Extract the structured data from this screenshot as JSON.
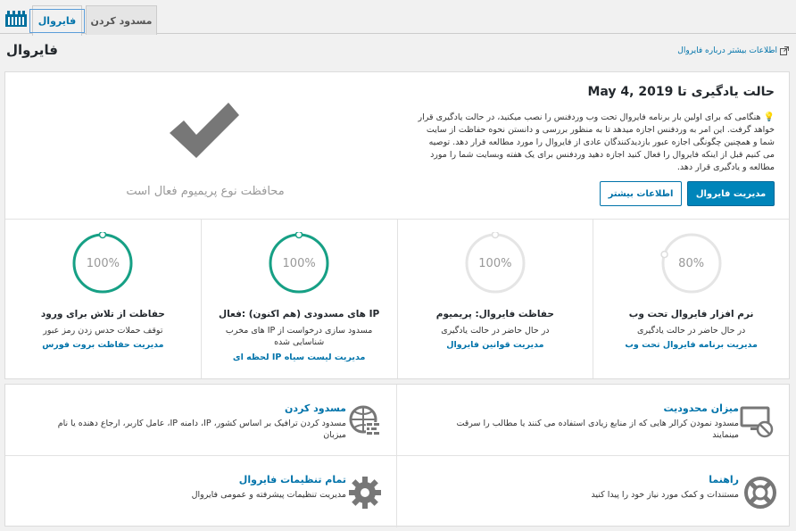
{
  "tabs": [
    {
      "label": "فایروال",
      "active": true
    },
    {
      "label": "مسدود کردن",
      "active": false
    }
  ],
  "learn_more_link": "اطلاعات بیشتر درباره فایروال",
  "page_title": "فایروال",
  "status": {
    "title": "حالت یادگیری تا May 4, 2019",
    "description": "هنگامی که برای اولین بار برنامه فایروال تحت وب وردفنس را نصب میکنید، در حالت یادگیری قرار خواهد گرفت. این امر به وردفنس اجازه میدهد تا به منظور بررسی و دانستن نحوه حفاظت از سایت شما و همچنین چگونگی اجازه عبور بازدیدکنندگان عادی از فایروال را مورد مطالعه قرار دهد. توصیه می کنیم قبل از اینکه فایروال را فعال کنید اجازه دهید وردفنس برای یک هفته وبسایت شما را مورد مطالعه و یادگیری قرار دهد.",
    "primary_button": "مدیریت فایروال",
    "secondary_button": "اطلاعات بیشتر",
    "premium_text": "محافظت نوع پریمیوم فعال است"
  },
  "stats": [
    {
      "percent_text": "100%",
      "value": 1.0,
      "active": true,
      "title": "حفاظت از تلاش برای ورود",
      "desc": "توقف حملات حدس زدن رمز عبور",
      "link": "مدیریت حفاظت بروت فورس"
    },
    {
      "percent_text": "100%",
      "value": 1.0,
      "active": true,
      "title": "IP های مسدودی (هم اکنون) :فعال",
      "desc": "مسدود سازی درخواست از IP های مخرب شناسایی شده",
      "link": "مدیریت لیست سیاه IP لحظه ای"
    },
    {
      "percent_text": "100%",
      "value": 1.0,
      "active": false,
      "title": "حفاظت فایروال: پریمیوم",
      "desc": "در حال حاضر در حالت یادگیری",
      "link": "مدیریت قوانین فایروال"
    },
    {
      "percent_text": "80%",
      "value": 0.8,
      "active": false,
      "title": "نرم افزار فایروال تحت وب",
      "desc": "در حال حاضر در حالت یادگیری",
      "link": "مدیریت برنامه فایروال تحت وب"
    }
  ],
  "features": {
    "blocking": {
      "title": "مسدود کردن",
      "desc": "مسدود کردن ترافیک بر اساس کشور، IP، دامنه IP، عامل کاربر، ارجاع دهنده یا نام میزبان"
    },
    "rate_limiting": {
      "title": "میزان محدودیت",
      "desc": "مسدود نمودن کرالر هایی که از منابع زیادی استفاده می کنند یا مطالب را سرقت مینمایند"
    },
    "all_settings": {
      "title": "تمام تنظیمات فایروال",
      "desc": "مدیریت تنظیمات پیشرفته و عمومی فایروال"
    },
    "help": {
      "title": "راهنما",
      "desc": "مستندات و کمک مورد نیاز خود را پیدا کنید"
    }
  },
  "colors": {
    "accent": "#0073aa",
    "primary_button": "#0085ba",
    "ring_active": "#16a085",
    "ring_inactive": "#e5e5e5",
    "check": "#777777"
  },
  "icons": [
    "wordfence-logo-icon",
    "external-link-icon",
    "checkmark-icon",
    "bulb-icon",
    "globe-block-icon",
    "monitor-block-icon",
    "gear-icon",
    "lifebuoy-icon"
  ]
}
